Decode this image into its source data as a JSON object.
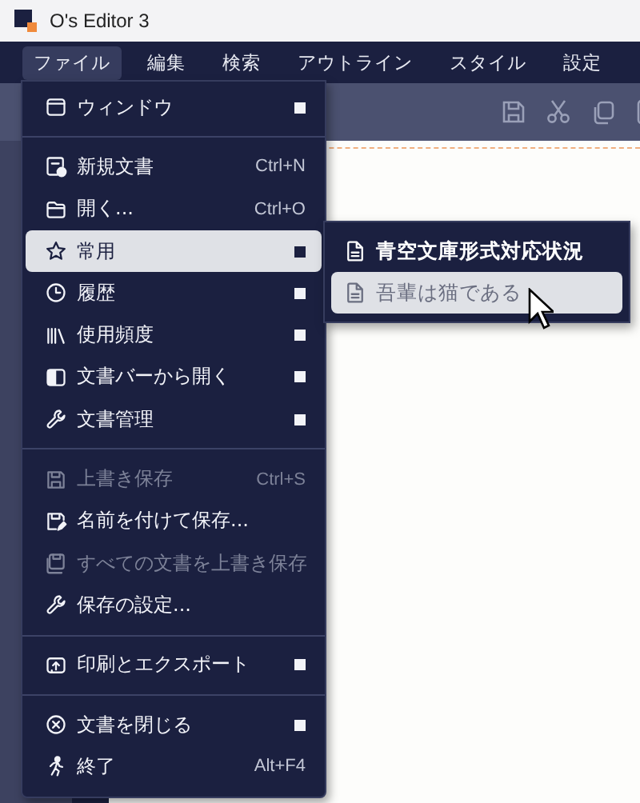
{
  "window": {
    "title": "O's Editor 3"
  },
  "menubar": [
    {
      "label": "ファイル",
      "selected": true
    },
    {
      "label": "編集",
      "selected": false
    },
    {
      "label": "検索",
      "selected": false
    },
    {
      "label": "アウトライン",
      "selected": false
    },
    {
      "label": "スタイル",
      "selected": false
    },
    {
      "label": "設定",
      "selected": false
    }
  ],
  "file_menu": {
    "sections": [
      [
        {
          "label": "ウィンドウ",
          "has_submenu": true,
          "disabled": false,
          "selected": false
        }
      ],
      [
        {
          "label": "新規文書",
          "shortcut": "Ctrl+N",
          "has_submenu": false,
          "disabled": false,
          "selected": false
        },
        {
          "label": "開く...",
          "shortcut": "Ctrl+O",
          "has_submenu": false,
          "disabled": false,
          "selected": false
        },
        {
          "label": "常用",
          "has_submenu": true,
          "disabled": false,
          "selected": true
        },
        {
          "label": "履歴",
          "has_submenu": true,
          "disabled": false,
          "selected": false
        },
        {
          "label": "使用頻度",
          "has_submenu": true,
          "disabled": false,
          "selected": false
        },
        {
          "label": "文書バーから開く",
          "has_submenu": true,
          "disabled": false,
          "selected": false
        },
        {
          "label": "文書管理",
          "has_submenu": true,
          "disabled": false,
          "selected": false
        }
      ],
      [
        {
          "label": "上書き保存",
          "shortcut": "Ctrl+S",
          "has_submenu": false,
          "disabled": true,
          "selected": false
        },
        {
          "label": "名前を付けて保存...",
          "has_submenu": false,
          "disabled": false,
          "selected": false
        },
        {
          "label": "すべての文書を上書き保存",
          "has_submenu": false,
          "disabled": true,
          "selected": false
        },
        {
          "label": "保存の設定...",
          "has_submenu": false,
          "disabled": false,
          "selected": false
        }
      ],
      [
        {
          "label": "印刷とエクスポート",
          "has_submenu": true,
          "disabled": false,
          "selected": false
        }
      ],
      [
        {
          "label": "文書を閉じる",
          "has_submenu": true,
          "disabled": false,
          "selected": false
        },
        {
          "label": "終了",
          "shortcut": "Alt+F4",
          "has_submenu": false,
          "disabled": false,
          "selected": false
        }
      ]
    ]
  },
  "submenu": {
    "items": [
      {
        "label": "青空文庫形式対応状況",
        "selected": false
      },
      {
        "label": "吾輩は猫である",
        "selected": true
      }
    ]
  }
}
